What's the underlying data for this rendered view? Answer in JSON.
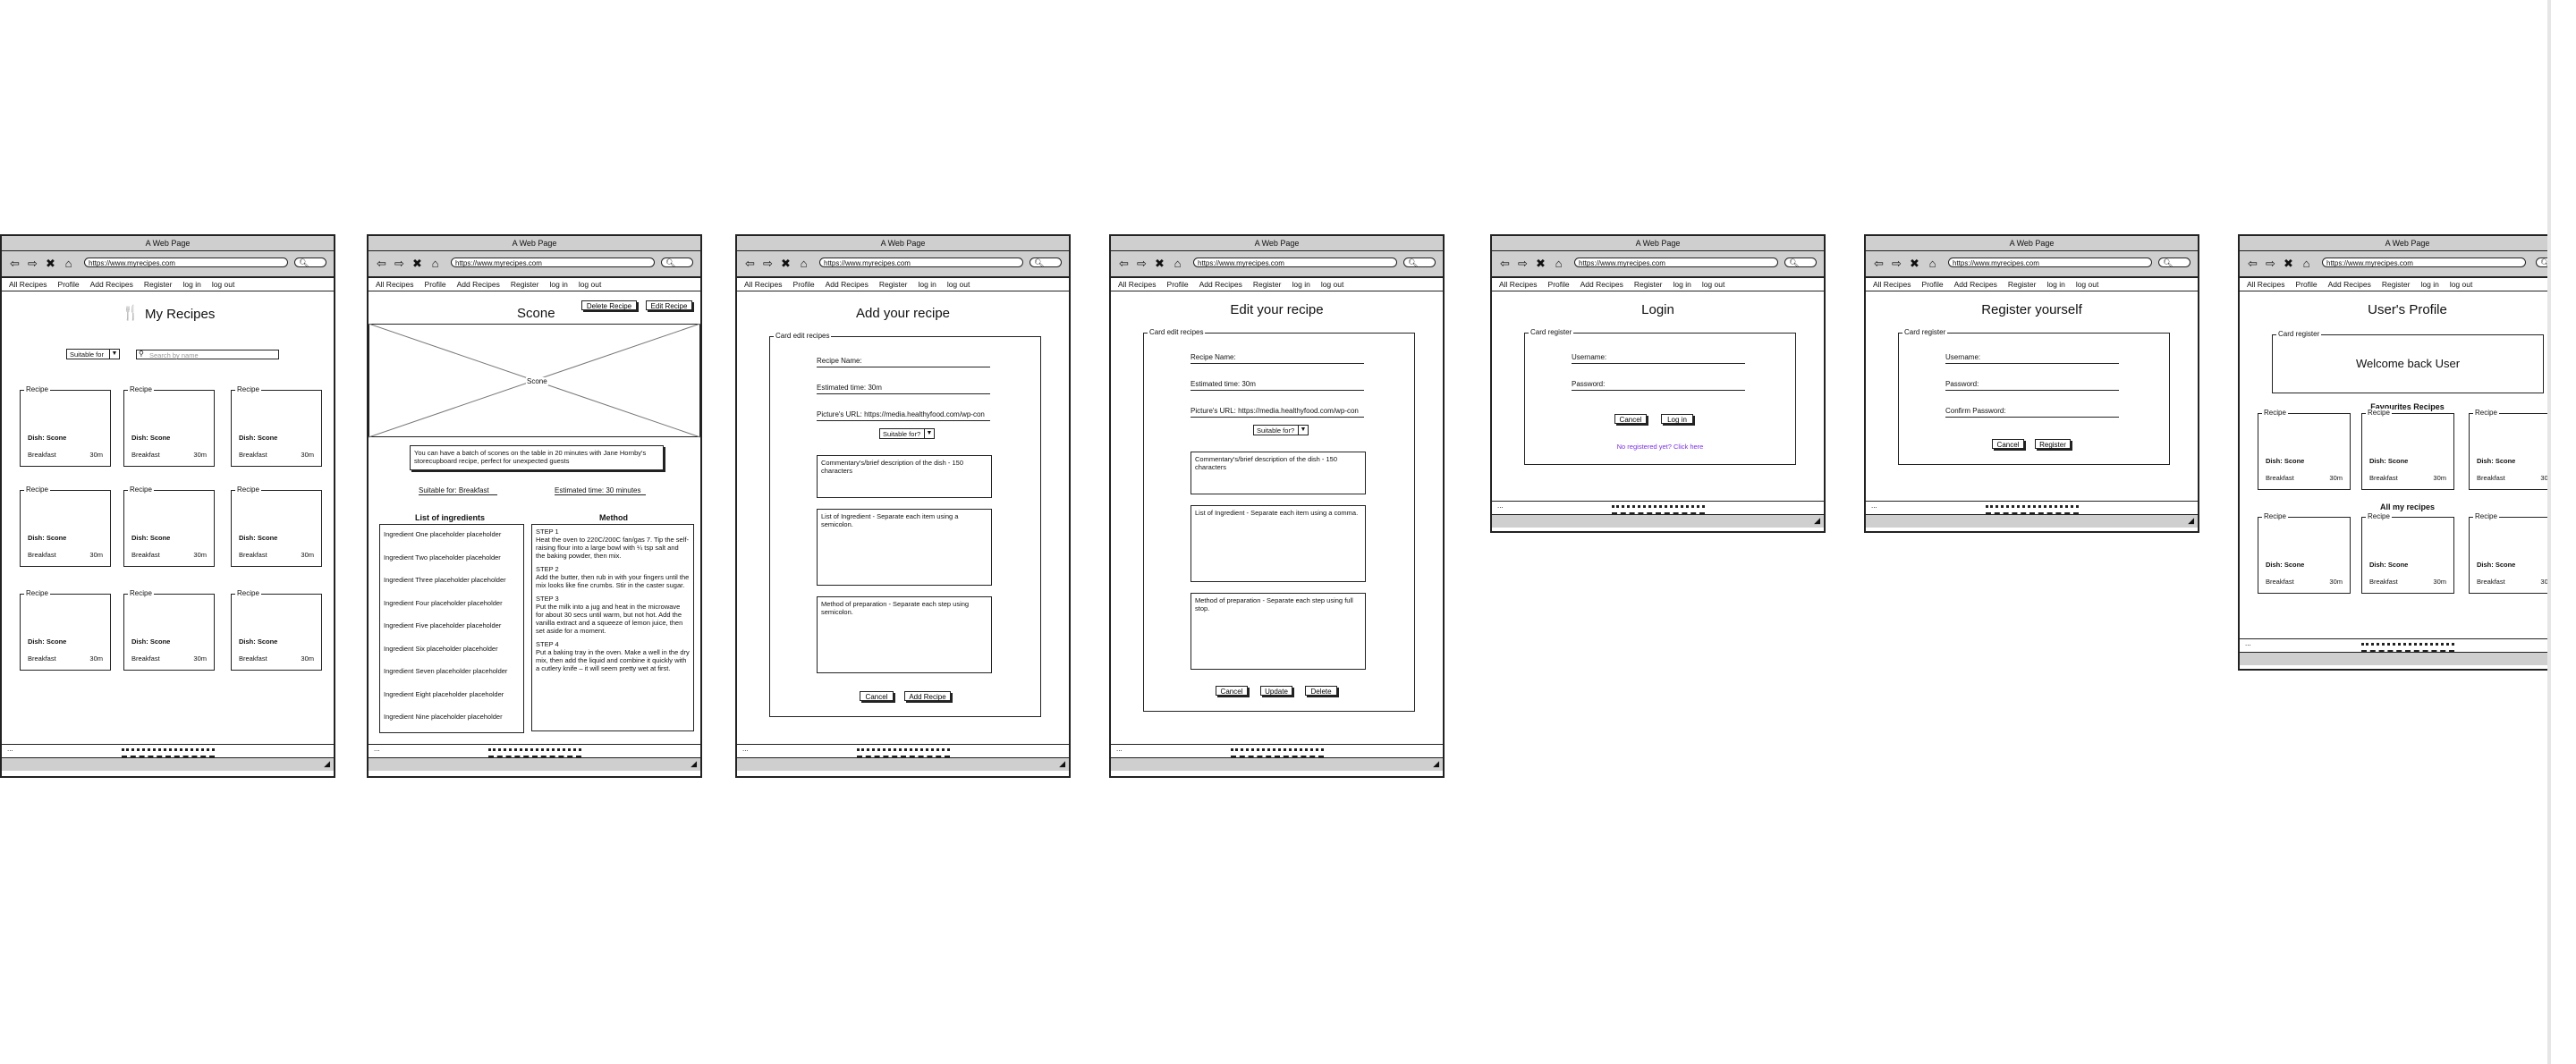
{
  "browser": {
    "title": "A Web Page",
    "url": "https://www.myrecipes.com",
    "menu": [
      "All Recipes",
      "Profile",
      "Add Recipes",
      "Register",
      "log in",
      "log out"
    ],
    "status_dots": "..."
  },
  "my_recipes": {
    "heading": "My Recipes",
    "filter_select": "Suitable for",
    "search_placeholder": "Search by name",
    "card": {
      "legend": "Recipe",
      "dish": "Dish: Scone",
      "meal": "Breakfast",
      "time": "30m"
    }
  },
  "recipe_detail": {
    "title": "Scone",
    "delete_button": "Delete Recipe",
    "edit_button": "Edit Recipe",
    "image_label": "Scone",
    "description": "You can have a batch of scones on the table in 20 minutes with Jane Hornby's storecupboard recipe, perfect for unexpected guests",
    "suitable_for": "Suitable for: Breakfast",
    "estimated_time": "Estimated time: 30 minutes",
    "ingredients_heading": "List of ingredients",
    "method_heading": "Method",
    "ingredients": [
      "Ingredient One placeholder placeholder",
      "Ingredient Two placeholder placeholder",
      "Ingredient Three placeholder placeholder",
      "Ingredient Four placeholder placeholder",
      "Ingredient Five placeholder placeholder",
      "Ingredient Six placeholder placeholder",
      "Ingredient Seven placeholder placeholder",
      "Ingredient Eight placeholder placeholder",
      "Ingredient Nine placeholder placeholder"
    ],
    "method_steps": [
      "STEP 1\nHeat the oven to 220C/200C fan/gas 7. Tip the self-raising flour into a large bowl with ¼ tsp salt and the baking powder, then mix.",
      "STEP 2\nAdd the butter, then rub in with your fingers until the mix looks like fine crumbs. Stir in the caster sugar.",
      "STEP 3\nPut the milk into a jug and heat in the microwave for about 30 secs until warm, but not hot. Add the vanilla extract and a squeeze of lemon juice, then set aside for a moment.",
      "STEP 4\nPut a baking tray in the oven. Make a well in the dry mix, then add the liquid and combine it quickly with a cutlery knife – it will seem pretty wet at first."
    ]
  },
  "add_recipe": {
    "heading": "Add your recipe",
    "legend": "Card edit recipes",
    "recipe_name": "Recipe Name:",
    "estimated_time": "Estimated time: 30m",
    "picture_url": "Picture's URL: https://media.healthyfood.com/wp-con",
    "suitable_select": "Suitable for?",
    "commentary": "Commentary's/brief description of the dish - 150 characters",
    "ingredients": "List of Ingredient - Separate each item using a semicolon.",
    "method": "Method of preparation - Separate each step using semicolon.",
    "cancel": "Cancel",
    "submit": "Add Recipe"
  },
  "edit_recipe": {
    "heading": "Edit your recipe",
    "legend": "Card edit recipes",
    "recipe_name": "Recipe Name:",
    "estimated_time": "Estimated time: 30m",
    "picture_url": "Picture's URL: https://media.healthyfood.com/wp-con",
    "suitable_select": "Suitable for?",
    "commentary": "Commentary's/brief description of the dish - 150 characters",
    "ingredients": "List of Ingredient - Separate each item using a comma.",
    "method": "Method of preparation - Separate each step using full stop.",
    "cancel": "Cancel",
    "update": "Update",
    "delete": "Delete"
  },
  "login": {
    "heading": "Login",
    "legend": "Card register",
    "username": "Username:",
    "password": "Password:",
    "cancel": "Cancel",
    "submit": "Log in",
    "register_link": "No registered yet? Click here"
  },
  "register": {
    "heading": "Register yourself",
    "legend": "Card register",
    "username": "Username:",
    "password": "Password:",
    "confirm": "Confirm Password:",
    "cancel": "Cancel",
    "submit": "Register"
  },
  "profile": {
    "heading": "User's Profile",
    "legend": "Card register",
    "welcome": "Welcome back User",
    "favourites_heading": "Favourites Recipes",
    "all_heading": "All my recipes",
    "card": {
      "legend": "Recipe",
      "dish": "Dish: Scone",
      "meal": "Breakfast",
      "time": "30m"
    }
  },
  "colors": {
    "link": "#7a2bff",
    "chrome": "#cfcfcf"
  }
}
